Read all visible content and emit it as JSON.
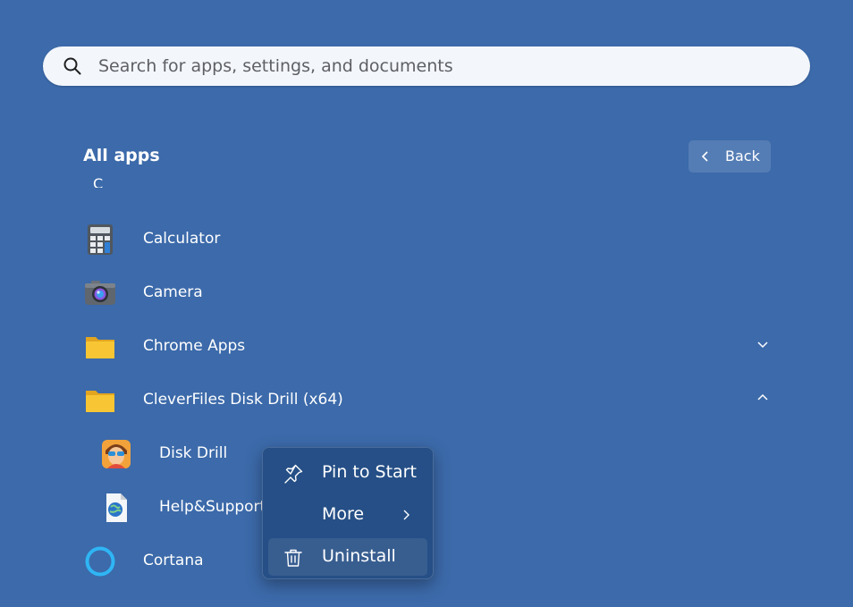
{
  "search": {
    "placeholder": "Search for apps, settings, and documents",
    "value": ""
  },
  "header": {
    "title": "All apps",
    "back_label": "Back"
  },
  "section_letter": "C",
  "apps": [
    {
      "name": "Calculator",
      "icon": "calculator-icon"
    },
    {
      "name": "Camera",
      "icon": "camera-icon"
    },
    {
      "name": "Chrome Apps",
      "icon": "folder-icon",
      "expanded": false
    },
    {
      "name": "CleverFiles Disk Drill (x64)",
      "icon": "folder-icon",
      "expanded": true
    },
    {
      "name": "Cortana",
      "icon": "cortana-icon"
    }
  ],
  "folder_children": [
    {
      "name": "Disk Drill",
      "icon": "disk-drill-icon"
    },
    {
      "name": "Help&Support",
      "icon": "help-support-icon"
    }
  ],
  "context_menu": {
    "items": [
      {
        "label": "Pin to Start",
        "icon": "pin-icon"
      },
      {
        "label": "More",
        "icon": "",
        "has_submenu": true
      },
      {
        "label": "Uninstall",
        "icon": "trash-icon",
        "highlighted": true
      }
    ]
  },
  "colors": {
    "background": "#3c6aaa",
    "menu_background": "#254f86",
    "search_background": "#f3f6fb",
    "folder": "#f8c634",
    "cortana": "#2fb5f5"
  }
}
